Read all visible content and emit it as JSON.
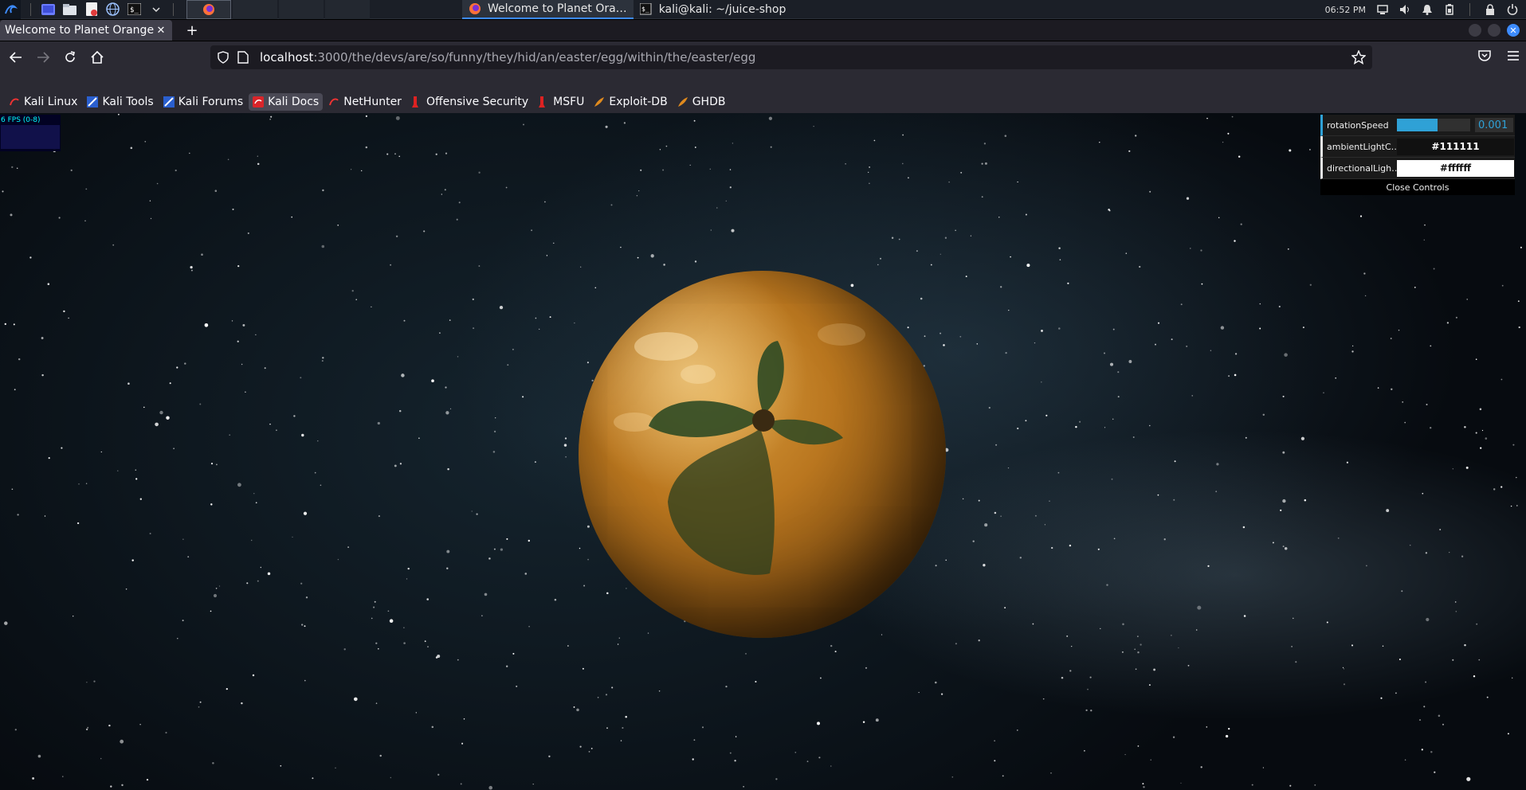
{
  "os_panel": {
    "clock": "06:52 PM",
    "tasks": [
      {
        "label": "Welcome to Planet Ora…",
        "icon": "firefox-icon",
        "active": true
      },
      {
        "label": "kali@kali: ~/juice-shop",
        "icon": "terminal-icon",
        "active": false
      }
    ]
  },
  "browser": {
    "tab_title": "Welcome to Planet Orangeu",
    "url_host": "localhost",
    "url_path": ":3000/the/devs/are/so/funny/they/hid/an/easter/egg/within/the/easter/egg",
    "bookmarks": [
      {
        "label": "Kali Linux",
        "icon": "kali-icon"
      },
      {
        "label": "Kali Tools",
        "icon": "kali-tools-icon"
      },
      {
        "label": "Kali Forums",
        "icon": "kali-forums-icon"
      },
      {
        "label": "Kali Docs",
        "icon": "kali-docs-icon"
      },
      {
        "label": "NetHunter",
        "icon": "nethunter-icon"
      },
      {
        "label": "Offensive Security",
        "icon": "offsec-icon"
      },
      {
        "label": "MSFU",
        "icon": "msfu-icon"
      },
      {
        "label": "Exploit-DB",
        "icon": "exploitdb-icon"
      },
      {
        "label": "GHDB",
        "icon": "ghdb-icon"
      }
    ]
  },
  "scene": {
    "fps_label": "6 FPS (0-8)",
    "controls": {
      "rotation_label": "rotationSpeed",
      "rotation_value": "0.001",
      "rotation_fill_fraction": 0.55,
      "ambient_label": "ambientLightC…",
      "ambient_value": "#111111",
      "directional_label": "directionalLigh…",
      "directional_value": "#ffffff",
      "close_label": "Close Controls"
    }
  },
  "colors": {
    "accent": "#2fa1d6",
    "planet": "#c17f25",
    "leaf": "#2f4a24"
  }
}
